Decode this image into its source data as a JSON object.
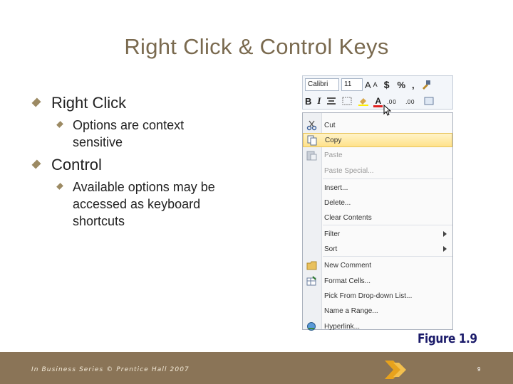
{
  "slide": {
    "title": "Right Click & Control Keys",
    "bullets": [
      {
        "text": "Right Click",
        "sub": "Options are context sensitive"
      },
      {
        "text": "Control",
        "sub": "Available options may be accessed as keyboard shortcuts"
      }
    ],
    "figure_label": "Figure 1.9",
    "footer_text": "In Business Series © Prentice Hall 2007",
    "page_number": "9"
  },
  "toolbar": {
    "font_name": "Calibri",
    "font_size": "11",
    "row1_glyphs": [
      "A",
      "A",
      "$",
      "%",
      ","
    ],
    "row2_glyphs": [
      "B",
      "I",
      "A"
    ]
  },
  "context_menu": {
    "items": [
      {
        "label": "Cut",
        "icon": "scissors-icon",
        "state": "normal"
      },
      {
        "label": "Copy",
        "icon": "copy-icon",
        "state": "highlighted"
      },
      {
        "label": "Paste",
        "icon": "paste-icon",
        "state": "disabled"
      },
      {
        "label": "Paste Special...",
        "icon": "",
        "state": "disabled"
      },
      {
        "label": "Insert...",
        "icon": "",
        "state": "normal"
      },
      {
        "label": "Delete...",
        "icon": "",
        "state": "normal"
      },
      {
        "label": "Clear Contents",
        "icon": "",
        "state": "normal"
      },
      {
        "label": "Filter",
        "icon": "",
        "state": "submenu"
      },
      {
        "label": "Sort",
        "icon": "",
        "state": "submenu"
      },
      {
        "label": "New Comment",
        "icon": "comment-icon",
        "state": "normal"
      },
      {
        "label": "Format Cells...",
        "icon": "format-cells-icon",
        "state": "normal"
      },
      {
        "label": "Pick From Drop-down List...",
        "icon": "",
        "state": "normal"
      },
      {
        "label": "Name a Range...",
        "icon": "",
        "state": "normal"
      },
      {
        "label": "Hyperlink...",
        "icon": "hyperlink-icon",
        "state": "normal"
      }
    ]
  },
  "colors": {
    "title": "#7a6a4f",
    "footer_bg": "#8a7457",
    "bullet": "#9c8a63",
    "highlight": "#ffe28a",
    "figure_label": "#1b1b6a",
    "logo": "#e7a21d"
  }
}
